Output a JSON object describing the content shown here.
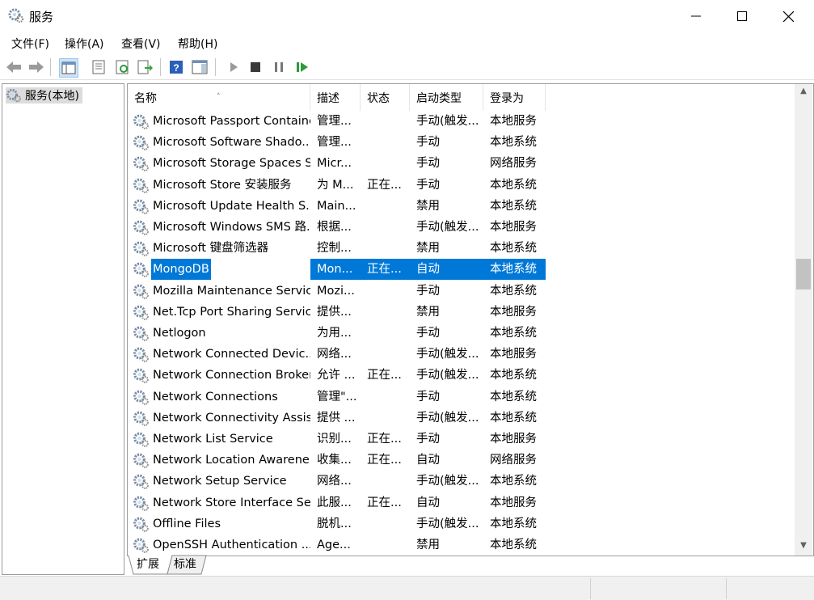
{
  "window": {
    "title": "服务",
    "minimize_glyph": "—",
    "maximize_glyph": "☐",
    "close_glyph": "✕"
  },
  "menu": [
    "文件(F)",
    "操作(A)",
    "查看(V)",
    "帮助(H)"
  ],
  "toolbar": {
    "buttons": [
      "back-arrow-icon",
      "forward-arrow-icon",
      "show-hide-console-tree-icon",
      "properties-icon",
      "refresh-icon",
      "export-list-icon",
      "help-icon",
      "show-action-pane-icon",
      "start-service-icon",
      "stop-service-icon",
      "pause-service-icon",
      "restart-service-icon"
    ]
  },
  "tree": {
    "root_label": "服务(本地)"
  },
  "table": {
    "headers": [
      "名称",
      "描述",
      "状态",
      "启动类型",
      "登录为"
    ],
    "rows": [
      {
        "name": "Microsoft Passport Container",
        "desc": "管理...",
        "status": "",
        "startup": "手动(触发...",
        "logon": "本地服务"
      },
      {
        "name": "Microsoft Software Shado...",
        "desc": "管理...",
        "status": "",
        "startup": "手动",
        "logon": "本地系统"
      },
      {
        "name": "Microsoft Storage Spaces S...",
        "desc": "Micr...",
        "status": "",
        "startup": "手动",
        "logon": "网络服务"
      },
      {
        "name": "Microsoft Store 安装服务",
        "desc": "为 M...",
        "status": "正在...",
        "startup": "手动",
        "logon": "本地系统"
      },
      {
        "name": "Microsoft Update Health S...",
        "desc": "Main...",
        "status": "",
        "startup": "禁用",
        "logon": "本地系统"
      },
      {
        "name": "Microsoft Windows SMS 路...",
        "desc": "根据...",
        "status": "",
        "startup": "手动(触发...",
        "logon": "本地服务"
      },
      {
        "name": "Microsoft 键盘筛选器",
        "desc": "控制...",
        "status": "",
        "startup": "禁用",
        "logon": "本地系统"
      },
      {
        "name": "MongoDB",
        "desc": "Mon...",
        "status": "正在...",
        "startup": "自动",
        "logon": "本地系统",
        "selected": true
      },
      {
        "name": "Mozilla Maintenance Service",
        "desc": "Mozi...",
        "status": "",
        "startup": "手动",
        "logon": "本地系统"
      },
      {
        "name": "Net.Tcp Port Sharing Service",
        "desc": "提供...",
        "status": "",
        "startup": "禁用",
        "logon": "本地服务"
      },
      {
        "name": "Netlogon",
        "desc": "为用...",
        "status": "",
        "startup": "手动",
        "logon": "本地系统"
      },
      {
        "name": "Network Connected Devic...",
        "desc": "网络...",
        "status": "",
        "startup": "手动(触发...",
        "logon": "本地服务"
      },
      {
        "name": "Network Connection Broker",
        "desc": "允许 ...",
        "status": "正在...",
        "startup": "手动(触发...",
        "logon": "本地系统"
      },
      {
        "name": "Network Connections",
        "desc": "管理\"...",
        "status": "",
        "startup": "手动",
        "logon": "本地系统"
      },
      {
        "name": "Network Connectivity Assis...",
        "desc": "提供 ...",
        "status": "",
        "startup": "手动(触发...",
        "logon": "本地系统"
      },
      {
        "name": "Network List Service",
        "desc": "识别...",
        "status": "正在...",
        "startup": "手动",
        "logon": "本地服务"
      },
      {
        "name": "Network Location Awarene...",
        "desc": "收集...",
        "status": "正在...",
        "startup": "自动",
        "logon": "网络服务"
      },
      {
        "name": "Network Setup Service",
        "desc": "网络...",
        "status": "",
        "startup": "手动(触发...",
        "logon": "本地系统"
      },
      {
        "name": "Network Store Interface Se...",
        "desc": "此服...",
        "status": "正在...",
        "startup": "自动",
        "logon": "本地服务"
      },
      {
        "name": "Offline Files",
        "desc": "脱机...",
        "status": "",
        "startup": "手动(触发...",
        "logon": "本地系统"
      },
      {
        "name": "OpenSSH Authentication ...",
        "desc": "Age...",
        "status": "",
        "startup": "禁用",
        "logon": "本地系统"
      }
    ]
  },
  "tabs": [
    "扩展",
    "标准"
  ],
  "scrollbar": {
    "up_glyph": "▲",
    "down_glyph": "▼"
  },
  "colors": {
    "selection": "#0078d7",
    "gear": "#7a8ea8"
  }
}
